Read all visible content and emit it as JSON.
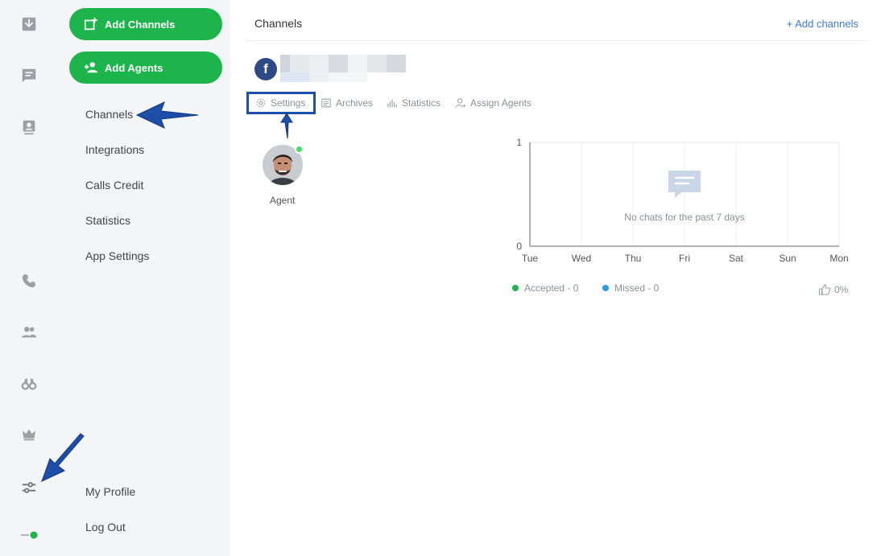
{
  "rail": {
    "icons": [
      "inbox-icon",
      "chat-icon",
      "contacts-icon",
      "phone-icon",
      "agents-icon",
      "binoculars-icon",
      "crown-icon",
      "settings-sliders-icon",
      "status-toggle-icon"
    ],
    "active_status_color": "#1db44b"
  },
  "sidebar": {
    "add_channels_label": "Add Channels",
    "add_agents_label": "Add Agents",
    "items": [
      "Channels",
      "Integrations",
      "Calls Credit",
      "Statistics",
      "App Settings"
    ],
    "bottom_items": [
      "My Profile",
      "Log Out"
    ]
  },
  "header": {
    "title": "Channels",
    "add_link": "+ Add channels"
  },
  "channel": {
    "platform_icon_letter": "f",
    "tabs": [
      "Settings",
      "Archives",
      "Statistics",
      "Assign Agents"
    ]
  },
  "agent": {
    "label": "Agent",
    "status": "online"
  },
  "chart_data": {
    "type": "line",
    "categories": [
      "Tue",
      "Wed",
      "Thu",
      "Fri",
      "Sat",
      "Sun",
      "Mon"
    ],
    "ylim": [
      0,
      1
    ],
    "y_ticks": [
      "1",
      "0"
    ],
    "empty_message": "No chats for the past 7 days",
    "series": [
      {
        "name": "Accepted - 0",
        "values": [
          0,
          0,
          0,
          0,
          0,
          0,
          0
        ],
        "color": "#1db44b"
      },
      {
        "name": "Missed - 0",
        "values": [
          0,
          0,
          0,
          0,
          0,
          0,
          0
        ],
        "color": "#2d9cdb"
      }
    ],
    "grid": true
  },
  "rating": {
    "value": "0%"
  },
  "colors": {
    "accent_green": "#1db44b",
    "link_blue": "#3a7bd5",
    "annotation_blue": "#1e4fa8",
    "facebook": "#2d4a86"
  }
}
